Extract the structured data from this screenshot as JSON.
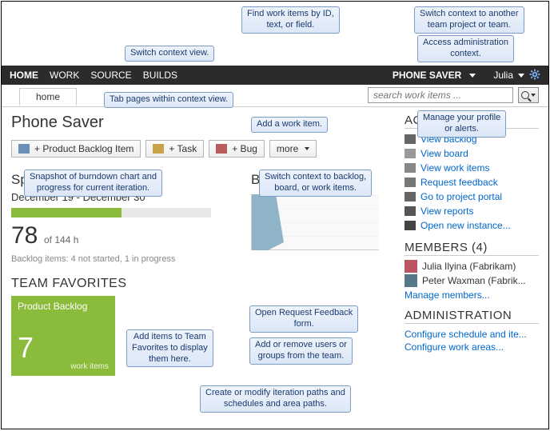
{
  "nav": {
    "items": [
      "HOME",
      "WORK",
      "SOURCE",
      "BUILDS"
    ],
    "project": "PHONE SAVER",
    "user": "Julia"
  },
  "tab": {
    "label": "home"
  },
  "search": {
    "placeholder": "search work items ..."
  },
  "page": {
    "title": "Phone Saver"
  },
  "toolbar": {
    "backlog": "+ Product Backlog Item",
    "task": "+ Task",
    "bug": "+ Bug",
    "more": "more"
  },
  "sprint": {
    "name": "Sprint 1",
    "dates": "December 19 - December 30",
    "hours": "78",
    "hours_suffix": "of 144 h",
    "progress_pct": 55,
    "backlog_status": "Backlog items: 4 not started, 1 in progress"
  },
  "favorites": {
    "heading": "TEAM FAVORITES",
    "tile": {
      "title": "Product Backlog",
      "count": "7",
      "sub": "work items"
    }
  },
  "burndown": {
    "title": "Burndown"
  },
  "side": {
    "activities": {
      "title": "ACTIVITIES",
      "items": [
        "View backlog",
        "View board",
        "View work items",
        "Request feedback",
        "Go to project portal",
        "View reports",
        "Open new instance..."
      ]
    },
    "members": {
      "title": "MEMBERS (4)",
      "list": [
        "Julia Ilyina (Fabrikam)",
        "Peter Waxman (Fabrik..."
      ],
      "manage": "Manage members..."
    },
    "admin": {
      "title": "ADMINISTRATION",
      "items": [
        "Configure schedule and ite...",
        "Configure work areas..."
      ]
    }
  },
  "callouts": {
    "c1": "Switch context view.",
    "c2": "Tab pages within context view.",
    "c3": "Find work items by ID,\ntext, or field.",
    "c4": "Switch context to another\nteam project or team.",
    "c5": "Access administration\ncontext.",
    "c6": "Manage your profile\nor alerts.",
    "c7": "Add a work item.",
    "c8": "Switch context to backlog,\nboard, or work items.",
    "c9": "Snapshot of burndown chart and\nprogress for current iteration.",
    "c10": "Open Request Feedback\nform.",
    "c11": "Add or remove users or\ngroups from the team.",
    "c12": "Add items to Team\nFavorites to display\nthem here.",
    "c13": "Create or modify iteration paths and\nschedules and area paths."
  }
}
